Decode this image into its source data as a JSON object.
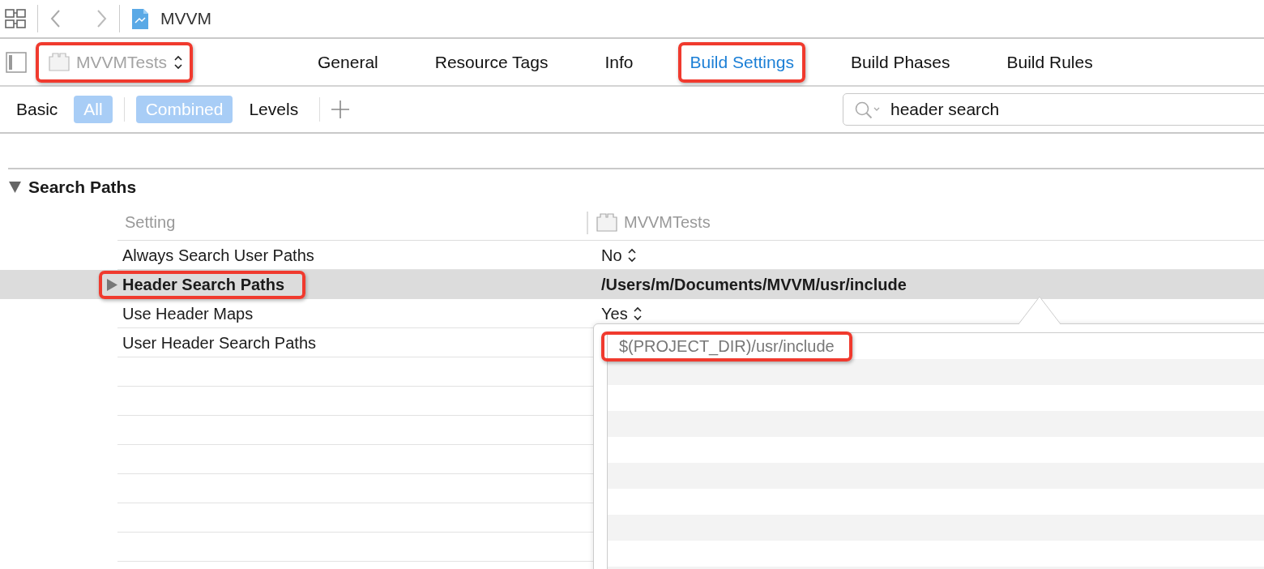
{
  "toolbar": {
    "breadcrumb": "MVVM"
  },
  "target_selector": {
    "label": "MVVMTests",
    "highlighted": true
  },
  "tabs": [
    {
      "label": "General",
      "selected": false,
      "highlighted": false
    },
    {
      "label": "Resource Tags",
      "selected": false,
      "highlighted": false
    },
    {
      "label": "Info",
      "selected": false,
      "highlighted": false
    },
    {
      "label": "Build Settings",
      "selected": true,
      "highlighted": true
    },
    {
      "label": "Build Phases",
      "selected": false,
      "highlighted": false
    },
    {
      "label": "Build Rules",
      "selected": false,
      "highlighted": false
    }
  ],
  "filters": {
    "scope": [
      {
        "label": "Basic",
        "selected": false
      },
      {
        "label": "All",
        "selected": true
      }
    ],
    "view": [
      {
        "label": "Combined",
        "selected": true
      },
      {
        "label": "Levels",
        "selected": false
      }
    ]
  },
  "search": {
    "value": "header search"
  },
  "section": {
    "title": "Search Paths",
    "expanded": true,
    "columns": [
      "Setting",
      "MVVMTests"
    ],
    "rows": [
      {
        "name": "Always Search User Paths",
        "value": "No",
        "kind": "popup",
        "selected": false,
        "highlighted": false
      },
      {
        "name": "Header Search Paths",
        "value": "/Users/m/Documents/MVVM/usr/include",
        "kind": "list",
        "expanded": false,
        "selected": true,
        "highlighted": true
      },
      {
        "name": "Use Header Maps",
        "value": "Yes",
        "kind": "popup",
        "selected": false,
        "highlighted": false
      },
      {
        "name": "User Header Search Paths",
        "kind": "text",
        "selected": false,
        "highlighted": false
      }
    ]
  },
  "popover": {
    "entries": [
      {
        "value": "$(PROJECT_DIR)/usr/include",
        "highlighted": true
      }
    ]
  }
}
